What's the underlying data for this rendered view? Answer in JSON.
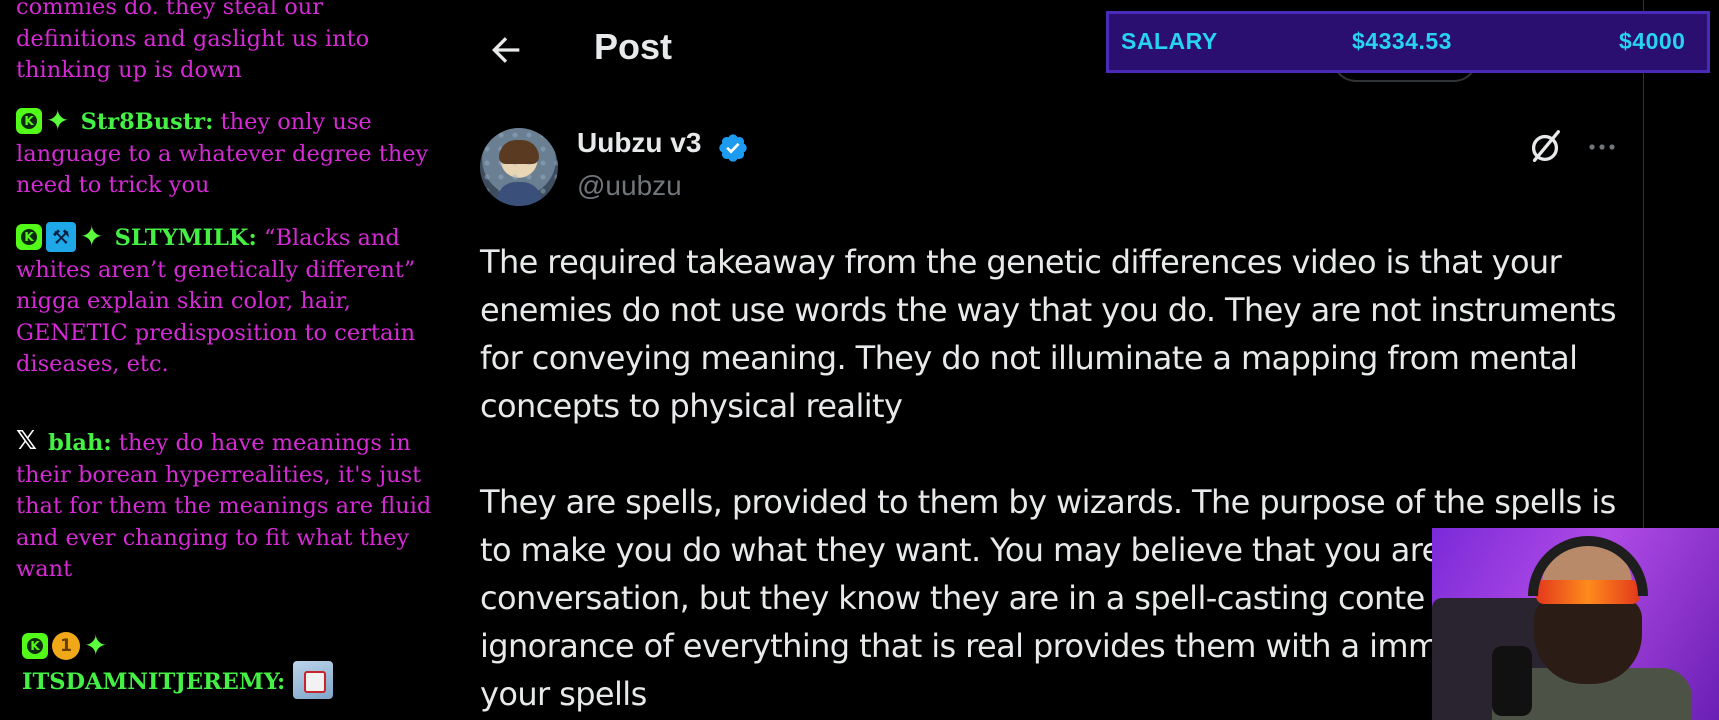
{
  "chat": {
    "messages": [
      {
        "text": "commies do. they steal our definitions and gaslight us into thinking up is down"
      },
      {
        "user": "Str8Bustr:",
        "text": "they only use language to a whatever degree they need to trick you"
      },
      {
        "user": "SLTYMILK:",
        "text": "“Blacks and whites aren’t genetically different” nigga explain skin color, hair, GENETIC predisposition to certain diseases, etc."
      },
      {
        "user": "blah:",
        "text": "they do have meanings in their borean hyperrealities, it's just that for them the meanings are fluid and ever changing to fit what they want"
      },
      {
        "user": "ITSDAMNITJEREMY:",
        "text": ""
      }
    ],
    "badges": {
      "k_label": "K",
      "subscriber_months": "1"
    }
  },
  "post": {
    "header_title": "Post",
    "author": {
      "display_name": "Uubzu v3",
      "handle": "@uubzu",
      "verified": true
    },
    "paragraphs": [
      "The required takeaway from the genetic differences video is that your enemies do not use words the way that you do. They are not instruments for conveying meaning. They do not illuminate a mapping from mental concepts to physical reality",
      "They are spells, provided to them by wizards. The purpose of the spells is to make you do what they want. You may believe that you are conversation, but they know they are in a spell-casting conte their ignorance of everything that is real provides them with a immunity to your spells"
    ],
    "icons": [
      "back-arrow-icon",
      "verified-badge-icon",
      "grok-icon",
      "more-icon"
    ]
  },
  "salary_overlay": {
    "label": "SALARY",
    "amount": "$4334.53",
    "goal": "$4000",
    "colors": {
      "background": "#2a0f70",
      "text": "#27d3f0"
    }
  },
  "colors": {
    "chat_text": "#d62ad6",
    "chat_username": "#45f045",
    "x_background": "#000000",
    "x_text": "#e7e9ea",
    "x_secondary": "#71767b",
    "verified_blue": "#1d9bf0"
  }
}
